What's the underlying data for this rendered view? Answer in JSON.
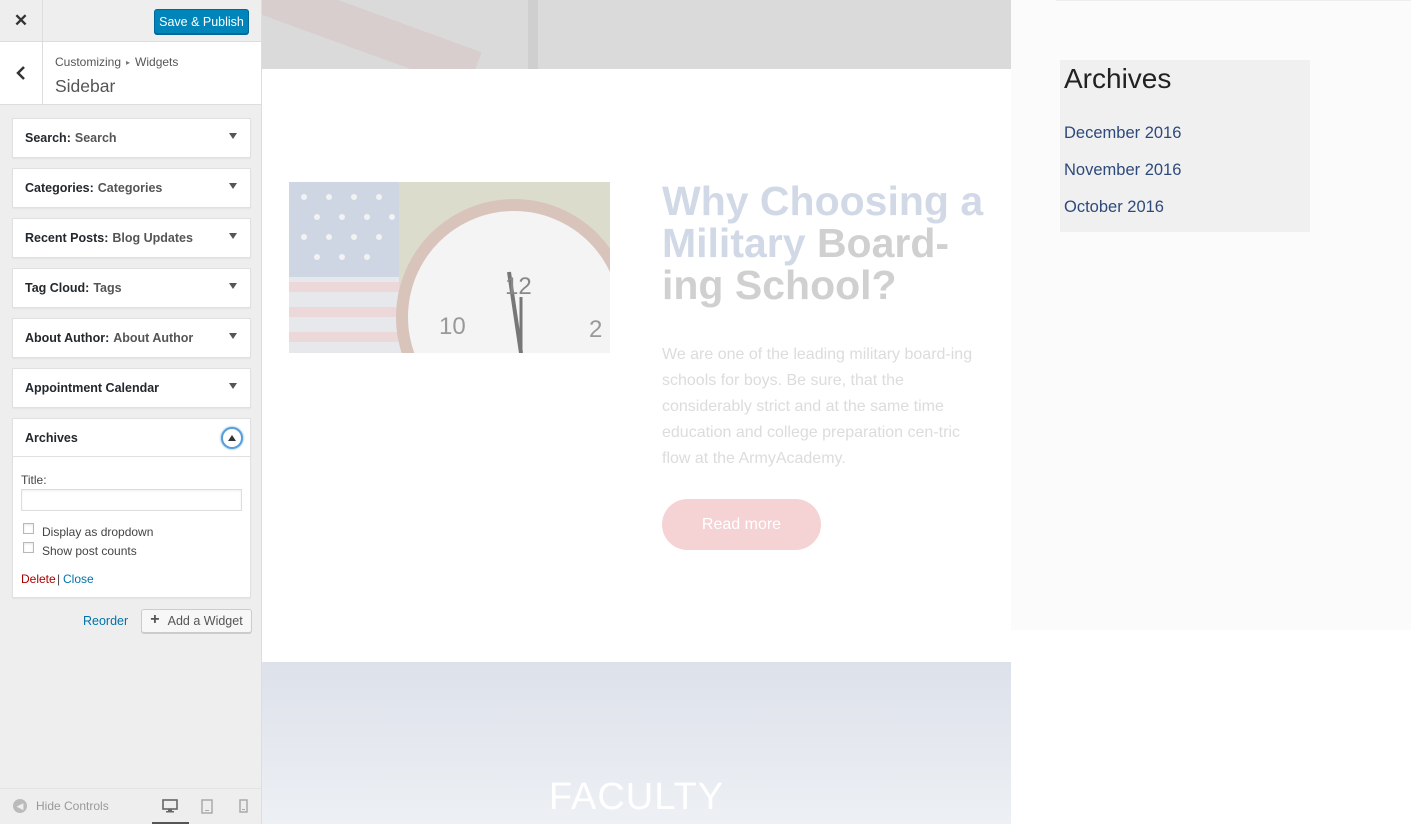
{
  "header": {
    "save_label": "Save & Publish"
  },
  "section": {
    "crumb_root": "Customizing",
    "crumb_sep": "▸",
    "crumb_parent": "Widgets",
    "name": "Sidebar"
  },
  "widgets": [
    {
      "type": "Search:",
      "title": "Search"
    },
    {
      "type": "Categories:",
      "title": "Categories"
    },
    {
      "type": "Recent Posts:",
      "title": "Blog Updates"
    },
    {
      "type": "Tag Cloud:",
      "title": "Tags"
    },
    {
      "type": "About Author:",
      "title": "About Author"
    },
    {
      "type": "Appointment Calendar",
      "title": ""
    },
    {
      "type": "Archives",
      "title": ""
    }
  ],
  "archives_form": {
    "title_label": "Title:",
    "title_value": "",
    "dropdown_label": "Display as dropdown",
    "counts_label": "Show post counts",
    "delete_label": "Delete",
    "link_sep": "|",
    "close_label": "Close"
  },
  "actions": {
    "reorder_label": "Reorder",
    "add_widget_label": "Add a Widget"
  },
  "footer": {
    "hide_controls_label": "Hide Controls",
    "active_device": "desktop"
  },
  "preview": {
    "heading_accent": "Why Choosing a Military",
    "heading_rest": " Board-ing School?",
    "body": "We are one of the leading military board-ing schools for boys. Be sure, that the considerably strict and at the same time education and college preparation cen-tric flow at the ArmyAcademy.",
    "read_more": "Read more",
    "faculty": "FACULTY",
    "archives_heading": "Archives",
    "archives": [
      "December 2016",
      "November 2016",
      "October 2016"
    ]
  },
  "colors": {
    "primary_button": "#0085ba",
    "link": "#0073aa",
    "delete": "#aa0000",
    "archive_link": "#2d4a7a"
  }
}
